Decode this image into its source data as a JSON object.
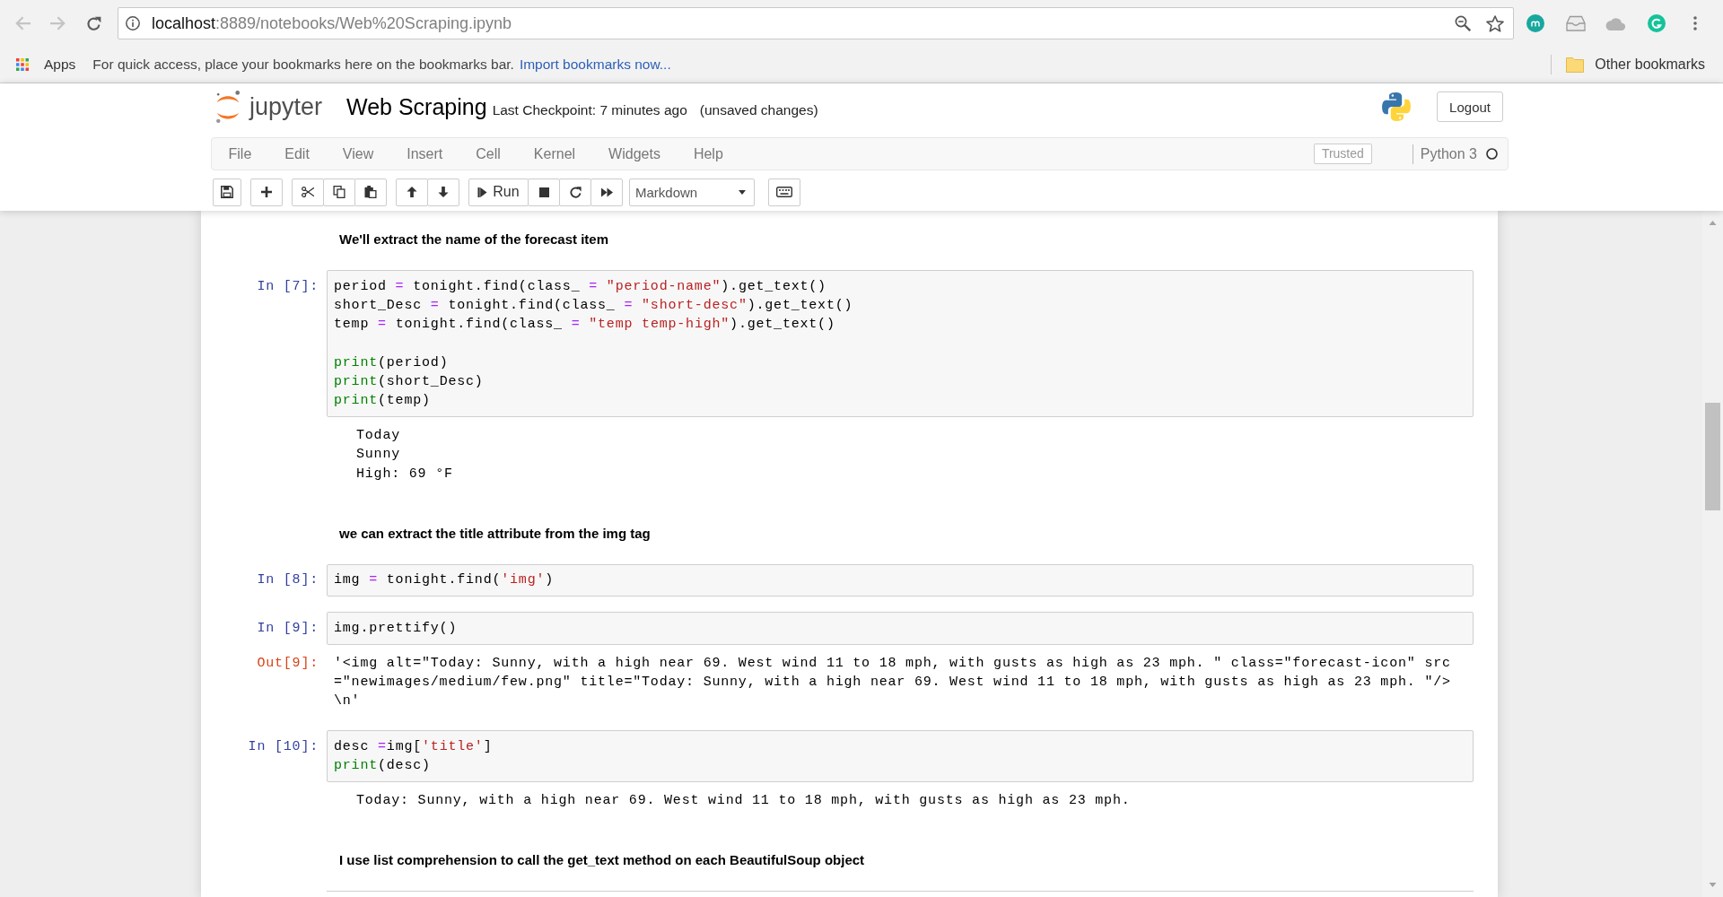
{
  "browser": {
    "nav": {
      "back": {
        "disabled": true
      },
      "forward": {
        "disabled": true
      }
    },
    "url": {
      "host": "localhost",
      "rest": ":8889/notebooks/Web%20Scraping.ipynb"
    },
    "bookmarked": false,
    "bookmarks_bar": {
      "apps_label": "Apps",
      "hint": "For quick access, place your bookmarks here on the bookmarks bar.",
      "import_link": "Import bookmarks now...",
      "other_bookmarks": "Other bookmarks"
    }
  },
  "header": {
    "logo_text": "jupyter",
    "notebook_name": "Web Scraping",
    "checkpoint": "Last Checkpoint: 7 minutes ago",
    "save_status": "(unsaved changes)",
    "logout_button": "Logout"
  },
  "menubar": {
    "items": [
      "File",
      "Edit",
      "View",
      "Insert",
      "Cell",
      "Kernel",
      "Widgets",
      "Help"
    ],
    "trusted_badge": "Trusted",
    "kernel_name": "Python 3",
    "kernel_busy": false
  },
  "toolbar": {
    "run_button": "Run",
    "cell_type": "Markdown"
  },
  "cells": [
    {
      "kind": "markdown",
      "text": "We'll extract the name of the forecast item"
    },
    {
      "kind": "code",
      "prompt": "In [7]:",
      "source": [
        [
          [
            {
              "kind": "name",
              "text": "period"
            },
            {
              "kind": "op",
              "text": " = "
            },
            {
              "kind": "name",
              "text": "tonight.find(class_"
            },
            {
              "kind": "op",
              "text": " = "
            },
            {
              "kind": "str",
              "text": "\"period-name\""
            },
            {
              "kind": "name",
              "text": ").get_text()"
            }
          ],
          [
            {
              "kind": "name",
              "text": "short_Desc"
            },
            {
              "kind": "op",
              "text": " = "
            },
            {
              "kind": "name",
              "text": "tonight.find(class_"
            },
            {
              "kind": "op",
              "text": " = "
            },
            {
              "kind": "str",
              "text": "\"short-desc\""
            },
            {
              "kind": "name",
              "text": ").get_text()"
            }
          ],
          [
            {
              "kind": "name",
              "text": "temp"
            },
            {
              "kind": "op",
              "text": " = "
            },
            {
              "kind": "name",
              "text": "tonight.find(class_"
            },
            {
              "kind": "op",
              "text": " = "
            },
            {
              "kind": "str",
              "text": "\"temp temp-high\""
            },
            {
              "kind": "name",
              "text": ").get_text()"
            }
          ]
        ],
        [
          [
            {
              "kind": "builtin",
              "text": "print"
            },
            {
              "kind": "name",
              "text": "(period)"
            }
          ],
          [
            {
              "kind": "builtin",
              "text": "print"
            },
            {
              "kind": "name",
              "text": "(short_Desc)"
            }
          ],
          [
            {
              "kind": "builtin",
              "text": "print"
            },
            {
              "kind": "name",
              "text": "(temp)"
            }
          ]
        ]
      ],
      "outputs": [
        {
          "kind": "stream",
          "text": "Today\nSunny\nHigh: 69 °F"
        }
      ]
    },
    {
      "kind": "markdown",
      "text": "we can extract the title attribute from the img tag"
    },
    {
      "kind": "code",
      "prompt": "In [8]:",
      "source": [
        [
          [
            {
              "kind": "name",
              "text": "img"
            },
            {
              "kind": "op",
              "text": " = "
            },
            {
              "kind": "name",
              "text": "tonight.find("
            },
            {
              "kind": "str",
              "text": "'img'"
            },
            {
              "kind": "name",
              "text": ")"
            }
          ]
        ]
      ]
    },
    {
      "kind": "code",
      "prompt": "In [9]:",
      "source": [
        [
          [
            {
              "kind": "name",
              "text": "img.prettify()"
            }
          ]
        ]
      ],
      "outputs": [
        {
          "kind": "execute_result",
          "prompt": "Out[9]:",
          "text": "'<img alt=\"Today: Sunny, with a high near 69. West wind 11 to 18 mph, with gusts as high as 23 mph. \" class=\"forecast-icon\" src=\"newimages/medium/few.png\" title=\"Today: Sunny, with a high near 69. West wind 11 to 18 mph, with gusts as high as 23 mph. \"/>\\n'"
        }
      ]
    },
    {
      "kind": "code",
      "prompt": "In [10]:",
      "source": [
        [
          [
            {
              "kind": "name",
              "text": "desc"
            },
            {
              "kind": "op",
              "text": " ="
            },
            {
              "kind": "name",
              "text": "img["
            },
            {
              "kind": "str",
              "text": "'title'"
            },
            {
              "kind": "name",
              "text": "]"
            }
          ],
          [
            {
              "kind": "builtin",
              "text": "print"
            },
            {
              "kind": "name",
              "text": "(desc)"
            }
          ]
        ]
      ],
      "outputs": [
        {
          "kind": "stream",
          "text": "Today: Sunny, with a high near 69. West wind 11 to 18 mph, with gusts as high as 23 mph."
        }
      ]
    },
    {
      "kind": "markdown",
      "text": "I use list comprehension to call the get_text method on each BeautifulSoup object"
    }
  ]
}
